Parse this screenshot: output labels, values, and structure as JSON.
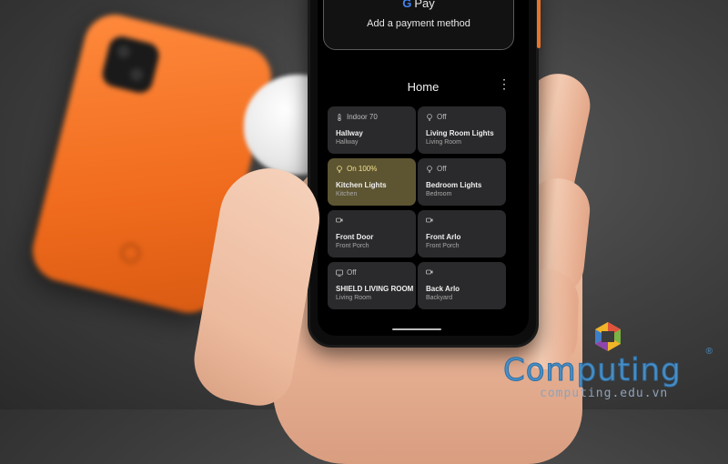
{
  "gpay": {
    "brand_letter": "G",
    "brand": "Pay",
    "subtitle": "Add a payment method"
  },
  "home": {
    "title": "Home",
    "menu_icon": "more-vert-icon"
  },
  "tiles": [
    {
      "status": "Indoor 70",
      "name": "Hallway",
      "room": "Hallway",
      "icon": "thermostat-icon",
      "on": false
    },
    {
      "status": "Off",
      "name": "Living Room Lights",
      "room": "Living Room",
      "icon": "lightbulb-icon",
      "on": false
    },
    {
      "status": "On 100%",
      "name": "Kitchen Lights",
      "room": "Kitchen",
      "icon": "lightbulb-icon",
      "on": true
    },
    {
      "status": "Off",
      "name": "Bedroom Lights",
      "room": "Bedroom",
      "icon": "lightbulb-icon",
      "on": false
    },
    {
      "status": "",
      "name": "Front Door",
      "room": "Front Porch",
      "icon": "camera-icon",
      "on": false
    },
    {
      "status": "",
      "name": "Front Arlo",
      "room": "Front Porch",
      "icon": "camera-icon",
      "on": false
    },
    {
      "status": "Off",
      "name": "SHIELD LIVING ROOM",
      "room": "Living Room",
      "icon": "tv-icon",
      "on": false
    },
    {
      "status": "",
      "name": "Back Arlo",
      "room": "Backyard",
      "icon": "camera-icon",
      "on": false
    }
  ],
  "watermark": {
    "name": "Computing",
    "reg": "®",
    "url": "computing.edu.vn"
  },
  "colors": {
    "on_tile": "#5d5532",
    "off_tile": "#2a2a2c",
    "orange_phone": "#f06b1d",
    "watermark_blue": "#4a8fc4"
  }
}
